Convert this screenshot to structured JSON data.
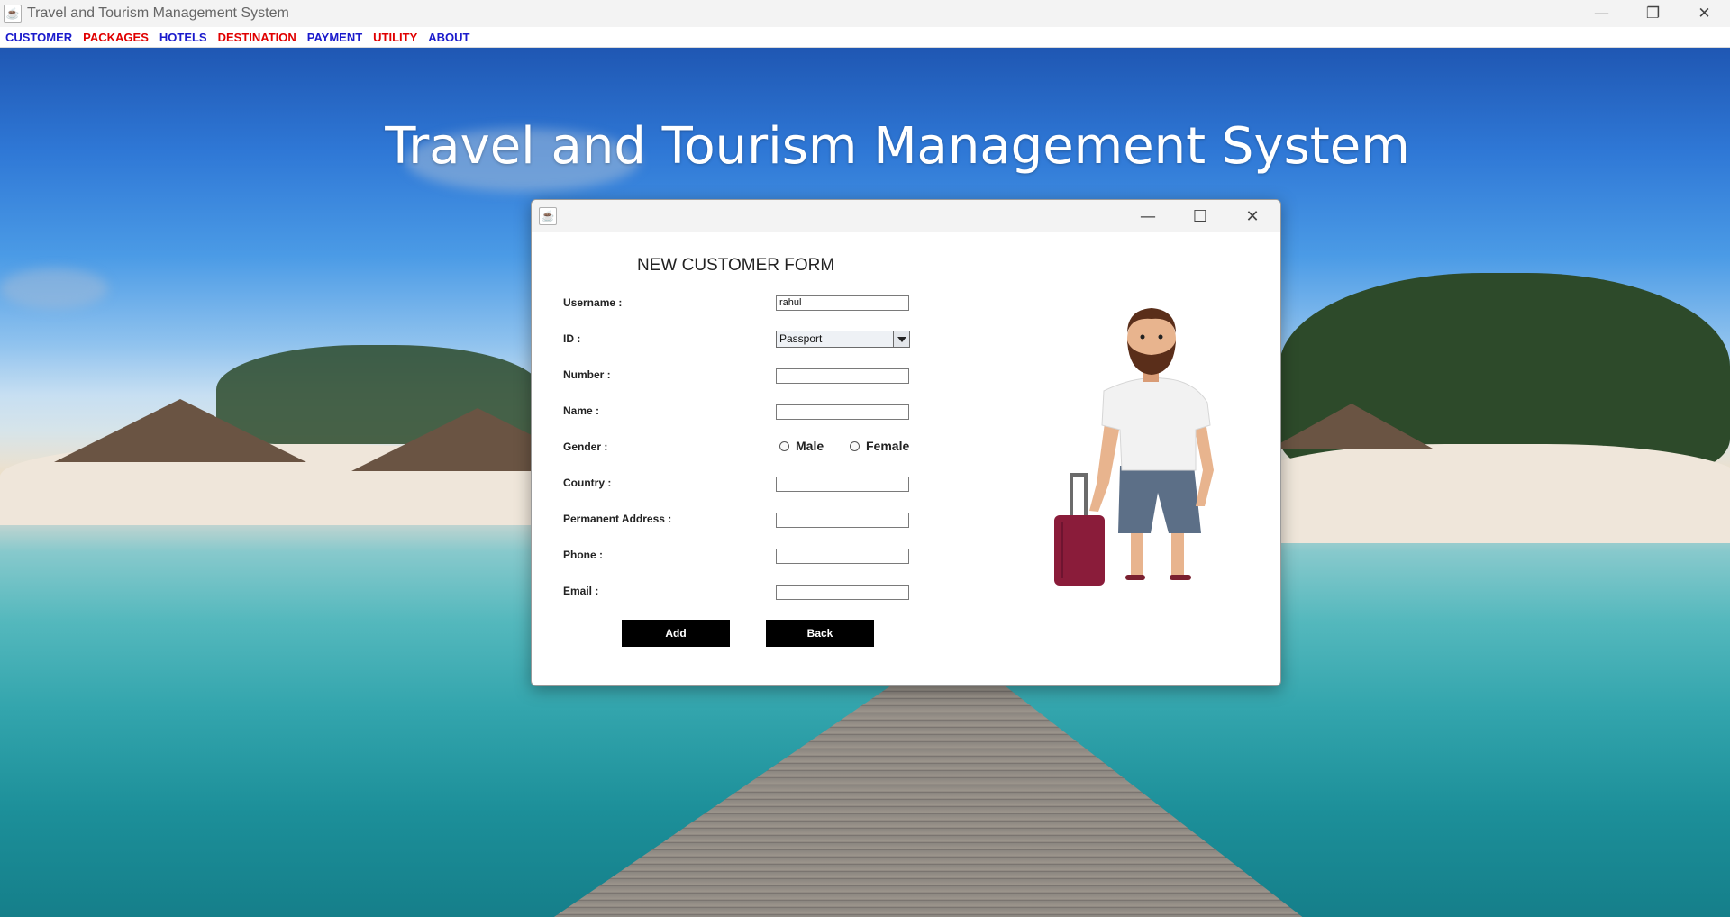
{
  "window": {
    "title": "Travel and Tourism Management System",
    "controls": {
      "minimize": "—",
      "restore": "❐",
      "close": "✕"
    }
  },
  "menu": [
    {
      "label": "CUSTOMER",
      "color": "#1a1acc"
    },
    {
      "label": "PACKAGES",
      "color": "#e00000"
    },
    {
      "label": "HOTELS",
      "color": "#1a1acc"
    },
    {
      "label": "DESTINATION",
      "color": "#e00000"
    },
    {
      "label": "PAYMENT",
      "color": "#1a1acc"
    },
    {
      "label": "UTILITY",
      "color": "#e00000"
    },
    {
      "label": "ABOUT",
      "color": "#1a1acc"
    }
  ],
  "banner": {
    "title": "Travel and Tourism Management System"
  },
  "dialog": {
    "controls": {
      "minimize": "—",
      "maximize": "☐",
      "close": "✕"
    },
    "heading": "NEW CUSTOMER FORM",
    "fields": {
      "username": {
        "label": "Username :",
        "value": "rahul"
      },
      "id": {
        "label": "ID :",
        "selected": "Passport"
      },
      "number": {
        "label": "Number :",
        "value": ""
      },
      "name": {
        "label": "Name :",
        "value": ""
      },
      "gender": {
        "label": "Gender :",
        "options": [
          "Male",
          "Female"
        ]
      },
      "country": {
        "label": "Country :",
        "value": ""
      },
      "address": {
        "label": "Permanent Address :",
        "value": ""
      },
      "phone": {
        "label": "Phone :",
        "value": ""
      },
      "email": {
        "label": "Email :",
        "value": ""
      }
    },
    "buttons": {
      "add": "Add",
      "back": "Back"
    },
    "illustration": "traveler-with-suitcase"
  }
}
